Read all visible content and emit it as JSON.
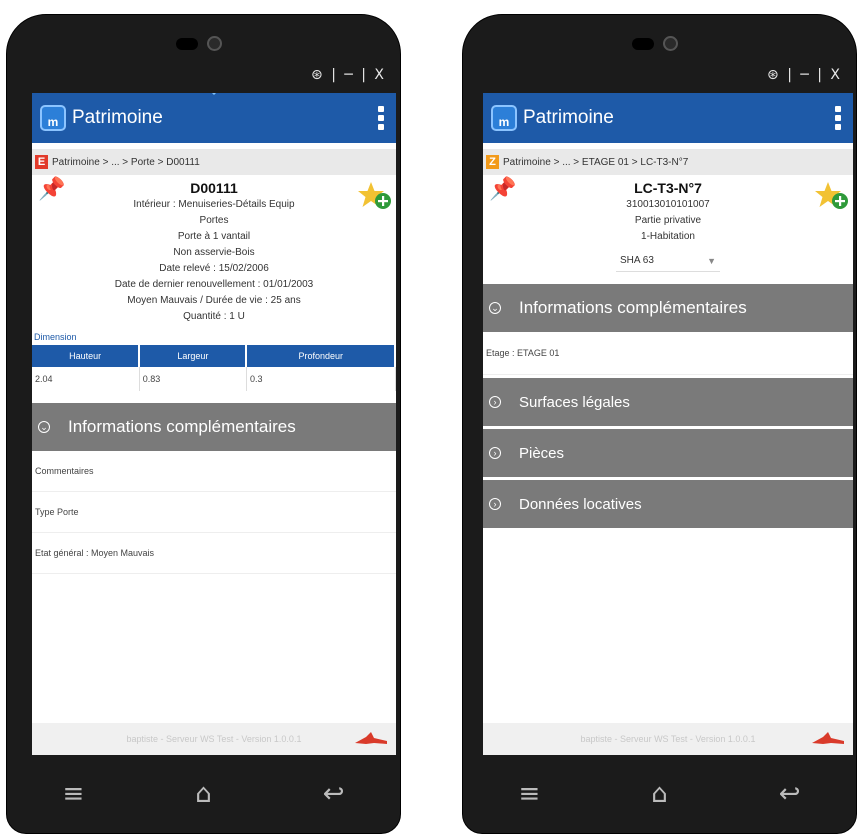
{
  "window_controls": "⊛ | ─ | X",
  "app": {
    "title": "Patrimoine",
    "logo_text": "m"
  },
  "left": {
    "breadcrumb_badge": "E",
    "breadcrumb": "Patrimoine > ... > Porte > D00111",
    "title": "D00111",
    "lines": [
      "Intérieur : Menuiseries-Détails Equip",
      "Portes",
      "Porte à 1 vantail",
      "Non asservie-Bois",
      "Date relevé : 15/02/2006",
      "Date de dernier renouvellement : 01/01/2003",
      "Moyen Mauvais / Durée de vie : 25 ans",
      "Quantité : 1 U"
    ],
    "dimension_label": "Dimension",
    "dimension_headers": [
      "Hauteur",
      "Largeur",
      "Profondeur"
    ],
    "dimension_values": [
      "2.04",
      "0.83",
      "0.3"
    ],
    "section_title": "Informations complémentaires",
    "fields": [
      "Commentaires",
      "Type Porte",
      "Etat général : Moyen Mauvais"
    ],
    "footer": "baptiste - Serveur WS Test - Version 1.0.0.1"
  },
  "right": {
    "breadcrumb_badge": "Z",
    "breadcrumb": "Patrimoine > ... > ETAGE 01 > LC-T3-N°7",
    "title": "LC-T3-N°7",
    "lines": [
      "310013010101007",
      "Partie privative",
      "1-Habitation"
    ],
    "select_value": "SHA 63",
    "section_title": "Informations complémentaires",
    "etage": "Etage : ETAGE 01",
    "sections": [
      "Surfaces légales",
      "Pièces",
      "Données locatives"
    ],
    "footer": "baptiste - Serveur WS Test - Version 1.0.0.1"
  },
  "colors": {
    "appbar": "#1e5aa8",
    "section": "#7a7a7a",
    "badge_left": "#e23a2a",
    "badge_right": "#f29a1a"
  }
}
